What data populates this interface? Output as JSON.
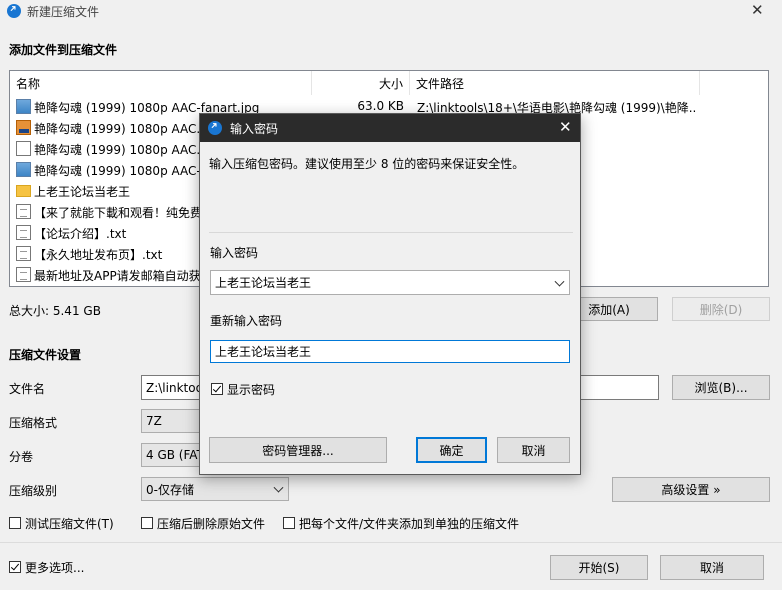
{
  "window": {
    "title": "新建压缩文件",
    "close_glyph": "✕"
  },
  "section_add": {
    "title": "添加文件到压缩文件"
  },
  "file_list": {
    "headers": {
      "name": "名称",
      "size": "大小",
      "path": "文件路径"
    },
    "rows": [
      {
        "icon": "image-file-icon",
        "name": "艳降勾魂 (1999) 1080p AAC-fanart.jpg",
        "size": "63.0 KB",
        "path": "Z:\\linktools\\18+\\华语电影\\艳降勾魂 (1999)\\艳降..."
      },
      {
        "icon": "video-file-icon",
        "name": "艳降勾魂 (1999) 1080p AAC.m",
        "size": "",
        "path": "ㄖ勾魂 (1999)\\艳降..."
      },
      {
        "icon": "nfo-file-icon",
        "name": "艳降勾魂 (1999) 1080p AAC.n",
        "size": "",
        "path": "ㄖ勾魂 (1999)\\艳降..."
      },
      {
        "icon": "image-file-icon",
        "name": "艳降勾魂 (1999) 1080p AAC-p",
        "size": "",
        "path": "ㄖ勾魂 (1999)\\艳降..."
      },
      {
        "icon": "folder-icon",
        "name": "上老王论坛当老王",
        "size": "",
        "path": "res\\上老王论坛当..."
      },
      {
        "icon": "text-file-icon",
        "name": "【来了就能下載和观看！纯免费",
        "size": "",
        "path": "res\\上老王论坛当..."
      },
      {
        "icon": "text-file-icon",
        "name": "【论坛介绍】.txt",
        "size": "",
        "path": "res\\上老王论坛当..."
      },
      {
        "icon": "text-file-icon",
        "name": "【永久地址发布页】.txt",
        "size": "",
        "path": "res\\上老王论坛当..."
      },
      {
        "icon": "text-file-icon",
        "name": "最新地址及APP请发邮箱自动获",
        "size": "",
        "path": "res\\上老王论坛当..."
      }
    ]
  },
  "summary": {
    "total_size": "总大小: 5.41 GB"
  },
  "list_buttons": {
    "add": "添加(A)",
    "delete": "删除(D)"
  },
  "settings": {
    "title": "压缩文件设置",
    "filename_label": "文件名",
    "filename_value": "Z:\\linktoo",
    "browse": "浏览(B)...",
    "format_label": "压缩格式",
    "format_value": "7Z",
    "split_label": "分卷",
    "split_value": "4 GB (FAT",
    "level_label": "压缩级别",
    "level_value": "0-仅存储",
    "advanced": "高级设置 »"
  },
  "options": {
    "test": "测试压缩文件(T)",
    "delete_after": "压缩后删除原始文件",
    "separate": "把每个文件/文件夹添加到单独的压缩文件",
    "more": "更多选项..."
  },
  "footer": {
    "start": "开始(S)",
    "cancel": "取消"
  },
  "password_dialog": {
    "title": "输入密码",
    "close_glyph": "✕",
    "message": "输入压缩包密码。建议使用至少 8 位的密码来保证安全性。",
    "password_label": "输入密码",
    "password_value": "上老王论坛当老王",
    "confirm_label": "重新输入密码",
    "confirm_value": "上老王论坛当老王",
    "show_password": "显示密码",
    "manager": "密码管理器...",
    "ok": "确定",
    "cancel": "取消"
  },
  "colors": {
    "accent": "#0078d7",
    "title_bar_dark": "#2b2b2b"
  }
}
